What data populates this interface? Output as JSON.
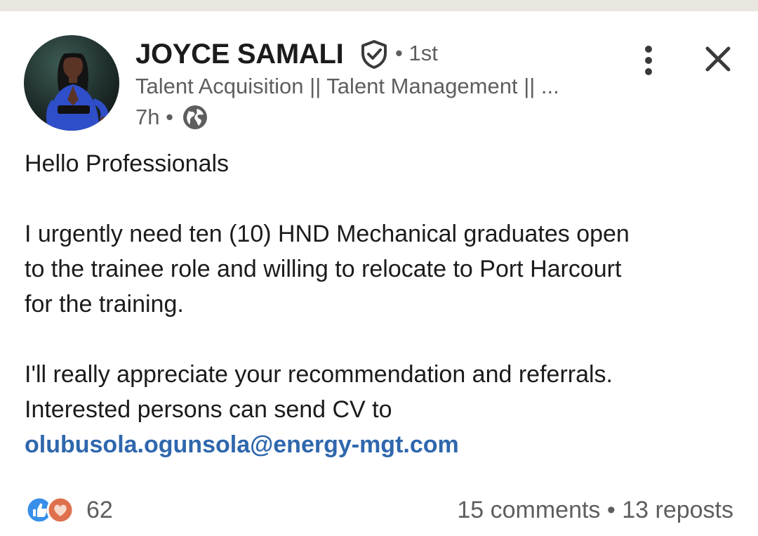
{
  "post": {
    "author": {
      "name": "JOYCE SAMALI",
      "connection_degree": "• 1st",
      "headline": "Talent Acquisition || Talent Management || ...",
      "verified": true
    },
    "meta": {
      "time_ago": "7h •",
      "visibility_icon": "globe-icon"
    },
    "body": {
      "greeting": "Hello Professionals",
      "paragraph_1_lines": [
        "I urgently need ten (10) HND Mechanical graduates open",
        "to the trainee role and willing to relocate to Port Harcourt",
        "for the training."
      ],
      "paragraph_2_lines": [
        "I'll really appreciate your recommendation and referrals.",
        "Interested persons can send CV to"
      ],
      "email": "olubusola.ogunsola@energy-mgt.com"
    },
    "stats": {
      "reaction_icons": [
        "like-icon",
        "love-icon"
      ],
      "reaction_count": "62",
      "comments": "15 comments",
      "separator": " • ",
      "reposts": "13 reposts"
    },
    "actions": {
      "more_icon": "vertical-ellipsis-icon",
      "close_icon": "close-icon"
    }
  },
  "colors": {
    "link": "#2f67ad",
    "secondary_text": "#5e5e5e",
    "primary_text": "#1b1b1b",
    "like_blue": "#378fe9",
    "love_red": "#df704d",
    "top_strip": "#e9e5df"
  }
}
